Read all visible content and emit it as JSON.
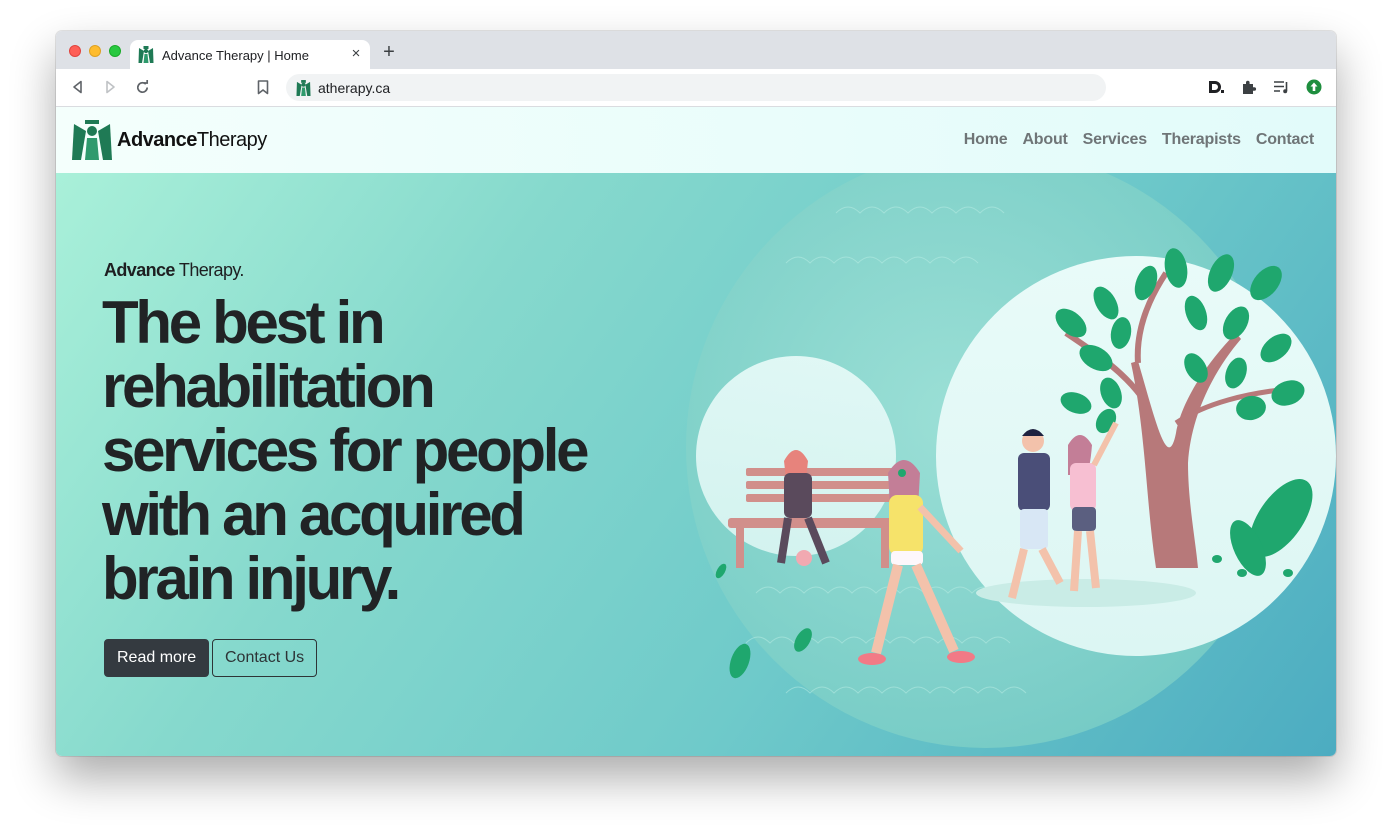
{
  "browser": {
    "tab_title": "Advance Therapy | Home",
    "tab_close": "×",
    "new_tab": "+",
    "url": "atherapy.ca",
    "toolbar_icons": [
      "back-arrow-icon",
      "forward-arrow-icon",
      "reload-icon",
      "bookmark-icon",
      "dashlane-extension-icon",
      "puzzle-extension-icon",
      "reading-list-icon",
      "update-icon"
    ]
  },
  "site": {
    "brand": {
      "bold": "Advance",
      "regular": "Therapy"
    },
    "nav": [
      "Home",
      "About",
      "Services",
      "Therapists",
      "Contact"
    ],
    "hero": {
      "eyebrow_bold": "Advance",
      "eyebrow_regular": " Therapy.",
      "title_lines": [
        "The best in",
        "rehabilitation",
        "services for people",
        "with an acquired",
        "brain injury."
      ],
      "primary_button": "Read more",
      "secondary_button": "Contact Us"
    }
  },
  "colors": {
    "logo_green": "#1f7a55",
    "hero_gradient_start": "#a9f0d9",
    "hero_gradient_end": "#4cacc1",
    "heading": "#212325",
    "nav_link": "#6f7577",
    "button_dark": "#343a40"
  }
}
